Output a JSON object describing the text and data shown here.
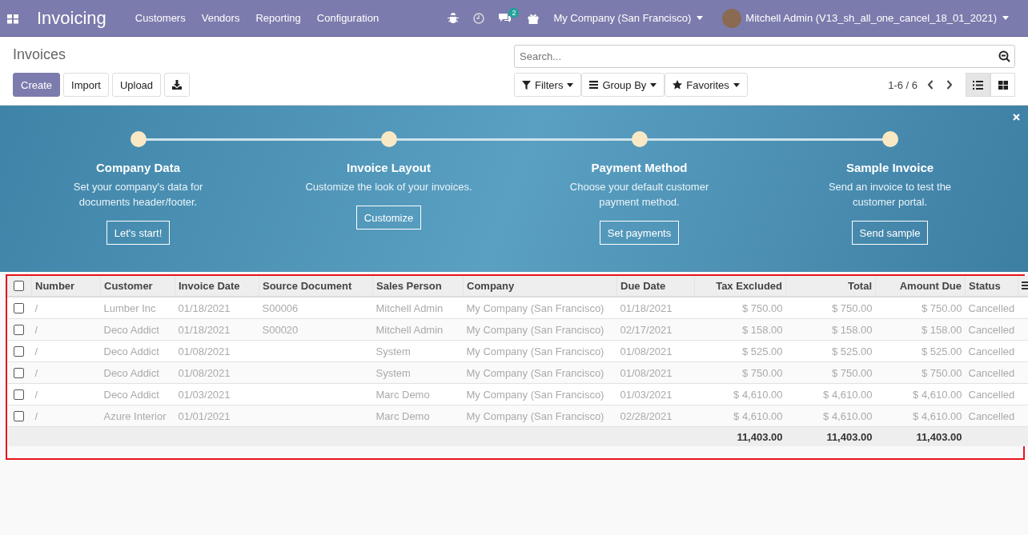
{
  "navbar": {
    "app_name": "Invoicing",
    "menu": [
      "Customers",
      "Vendors",
      "Reporting",
      "Configuration"
    ],
    "messages_badge": "2",
    "company": "My Company (San Francisco)",
    "user": "Mitchell Admin (V13_sh_all_one_cancel_18_01_2021)"
  },
  "control_panel": {
    "title": "Invoices",
    "buttons": [
      {
        "label": "Create",
        "kind": "primary"
      },
      {
        "label": "Import",
        "kind": "secondary"
      },
      {
        "label": "Upload",
        "kind": "secondary"
      }
    ],
    "search": {
      "placeholder": "Search..."
    },
    "filters": [
      {
        "label": "Filters",
        "kind": "filter"
      },
      {
        "label": "Group By",
        "kind": "group"
      },
      {
        "label": "Favorites",
        "kind": "star"
      }
    ],
    "pager": "1-6 / 6",
    "views": [
      {
        "kind": "list",
        "selected": true
      },
      {
        "kind": "kanban",
        "selected": false
      }
    ]
  },
  "onboarding": {
    "steps": [
      {
        "title": "Company Data",
        "description": "Set your company's data for\ndocuments header/footer.",
        "button": "Let's start!"
      },
      {
        "title": "Invoice Layout",
        "description": "Customize the look of your invoices.",
        "button": "Customize"
      },
      {
        "title": "Payment Method",
        "description": "Choose your default customer\npayment method.",
        "button": "Set payments"
      },
      {
        "title": "Sample Invoice",
        "description": "Send an invoice to test the\ncustomer portal.",
        "button": "Send sample"
      }
    ]
  },
  "table": {
    "select_all_checked": false,
    "columns": [
      "Number",
      "Customer",
      "Invoice Date",
      "Source Document",
      "Sales Person",
      "Company",
      "Due Date",
      "Tax Excluded",
      "Total",
      "Amount Due",
      "Status"
    ],
    "rows": [
      {
        "checked": false,
        "muted": true,
        "cells": [
          "/",
          "Lumber Inc",
          "01/18/2021",
          "S00006",
          "Mitchell Admin",
          "My Company (San Francisco)",
          "01/18/2021",
          "$ 750.00",
          "$ 750.00",
          "$ 750.00",
          "Cancelled"
        ]
      },
      {
        "checked": false,
        "muted": true,
        "cells": [
          "/",
          "Deco Addict",
          "01/18/2021",
          "S00020",
          "Mitchell Admin",
          "My Company (San Francisco)",
          "02/17/2021",
          "$ 158.00",
          "$ 158.00",
          "$ 158.00",
          "Cancelled"
        ]
      },
      {
        "checked": false,
        "muted": true,
        "cells": [
          "/",
          "Deco Addict",
          "01/08/2021",
          "",
          "System",
          "My Company (San Francisco)",
          "01/08/2021",
          "$ 525.00",
          "$ 525.00",
          "$ 525.00",
          "Cancelled"
        ]
      },
      {
        "checked": false,
        "muted": true,
        "cells": [
          "/",
          "Deco Addict",
          "01/08/2021",
          "",
          "System",
          "My Company (San Francisco)",
          "01/08/2021",
          "$ 750.00",
          "$ 750.00",
          "$ 750.00",
          "Cancelled"
        ]
      },
      {
        "checked": false,
        "muted": true,
        "cells": [
          "/",
          "Deco Addict",
          "01/03/2021",
          "",
          "Marc Demo",
          "My Company (San Francisco)",
          "01/03/2021",
          "$ 4,610.00",
          "$ 4,610.00",
          "$ 4,610.00",
          "Cancelled"
        ]
      },
      {
        "checked": false,
        "muted": true,
        "cells": [
          "/",
          "Azure Interior",
          "01/01/2021",
          "",
          "Marc Demo",
          "My Company (San Francisco)",
          "02/28/2021",
          "$ 4,610.00",
          "$ 4,610.00",
          "$ 4,610.00",
          "Cancelled"
        ]
      }
    ],
    "totals": {
      "tax_excluded": "11,403.00",
      "total": "11,403.00",
      "amount_due": "11,403.00"
    }
  }
}
